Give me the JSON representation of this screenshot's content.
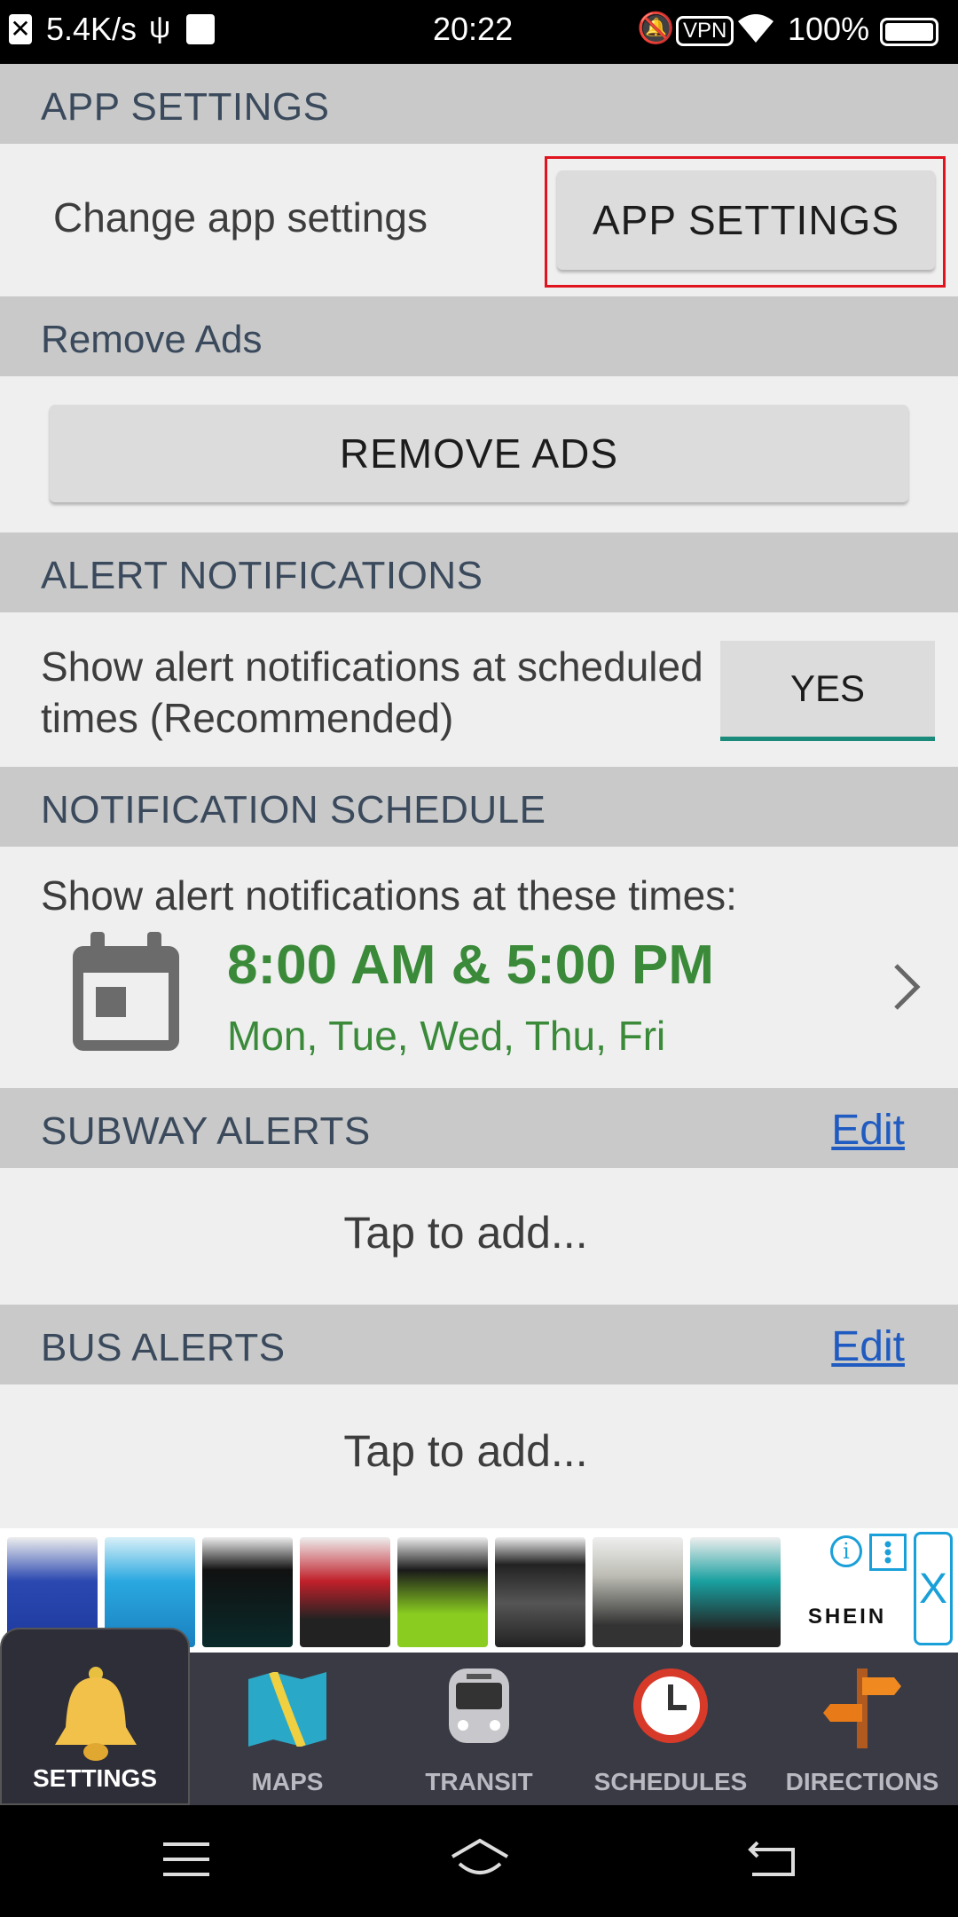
{
  "status_bar": {
    "net_speed": "5.4K/s",
    "time": "20:22",
    "vpn": "VPN",
    "battery": "100%"
  },
  "app_settings": {
    "header": "APP SETTINGS",
    "label": "Change app settings",
    "button": "APP SETTINGS"
  },
  "remove_ads": {
    "header": "Remove Ads",
    "button": "REMOVE ADS"
  },
  "alert_notifications": {
    "header": "ALERT NOTIFICATIONS",
    "label_line1": "Show alert notifications at scheduled",
    "label_line2": "times (Recommended)",
    "toggle": "YES"
  },
  "notification_schedule": {
    "header": "NOTIFICATION SCHEDULE",
    "label": "Show alert notifications at these times:",
    "times": "8:00 AM & 5:00 PM",
    "days": "Mon, Tue, Wed, Thu, Fri"
  },
  "subway_alerts": {
    "header": "SUBWAY ALERTS",
    "edit": "Edit",
    "placeholder": "Tap to add..."
  },
  "bus_alerts": {
    "header": "BUS ALERTS",
    "edit": "Edit",
    "placeholder": "Tap to add..."
  },
  "ad": {
    "brand": "SHEIN",
    "close": "X"
  },
  "bottom_nav": {
    "items": [
      {
        "label": "SETTINGS"
      },
      {
        "label": "MAPS"
      },
      {
        "label": "TRANSIT"
      },
      {
        "label": "SCHEDULES"
      },
      {
        "label": "DIRECTIONS"
      }
    ]
  },
  "colors": {
    "header_bg": "#c9c9c9",
    "header_text": "#3a4a5c",
    "schedule_green": "#3a8a3a",
    "link_blue": "#1f5bc0",
    "toggle_underline": "#1a8a7a",
    "highlight_red": "#e0141e"
  }
}
